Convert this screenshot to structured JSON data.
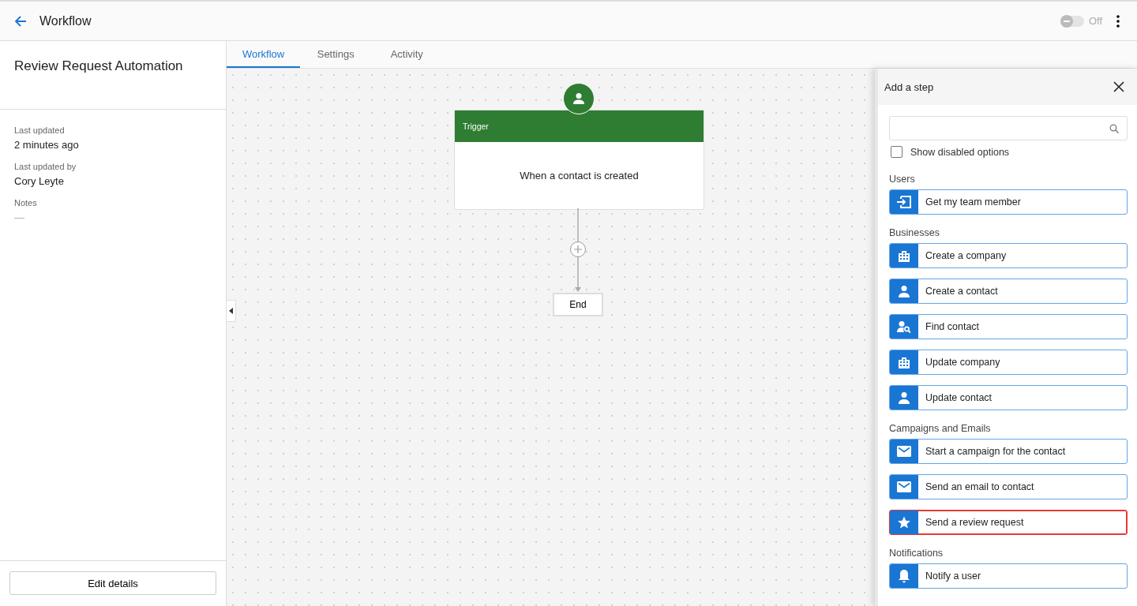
{
  "header": {
    "title": "Workflow",
    "toggle": {
      "on": false,
      "label": "Off"
    }
  },
  "sidebar": {
    "title": "Review Request Automation",
    "fields": [
      {
        "label": "Last updated",
        "value": "2 minutes ago"
      },
      {
        "label": "Last updated by",
        "value": "Cory Leyte"
      },
      {
        "label": "Notes",
        "value": "—"
      }
    ],
    "button": "Edit details"
  },
  "tabs": [
    {
      "label": "Workflow",
      "selected": true
    },
    {
      "label": "Settings",
      "selected": false
    },
    {
      "label": "Activity",
      "selected": false
    }
  ],
  "canvas": {
    "trigger": {
      "header": "Trigger",
      "text": "When a contact is created"
    },
    "end": "End"
  },
  "panel": {
    "title": "Add a step",
    "show_disabled": {
      "label": "Show disabled options",
      "checked": false
    },
    "sections": [
      {
        "title": "Users",
        "items": [
          {
            "label": "Get my team member",
            "kind": "enter",
            "selected": false
          }
        ]
      },
      {
        "title": "Businesses",
        "items": [
          {
            "label": "Create a company",
            "kind": "building",
            "selected": false
          },
          {
            "label": "Create a contact",
            "kind": "person",
            "selected": false
          },
          {
            "label": "Find contact",
            "kind": "person-search",
            "selected": false
          },
          {
            "label": "Update company",
            "kind": "building",
            "selected": false
          },
          {
            "label": "Update contact",
            "kind": "person",
            "selected": false
          }
        ]
      },
      {
        "title": "Campaigns and Emails",
        "items": [
          {
            "label": "Start a campaign for the contact",
            "kind": "mail",
            "selected": false
          },
          {
            "label": "Send an email to contact",
            "kind": "mail",
            "selected": false
          },
          {
            "label": "Send a review request",
            "kind": "star",
            "selected": true
          }
        ]
      },
      {
        "title": "Notifications",
        "items": [
          {
            "label": "Notify a user",
            "kind": "bell",
            "selected": false
          }
        ]
      }
    ]
  }
}
